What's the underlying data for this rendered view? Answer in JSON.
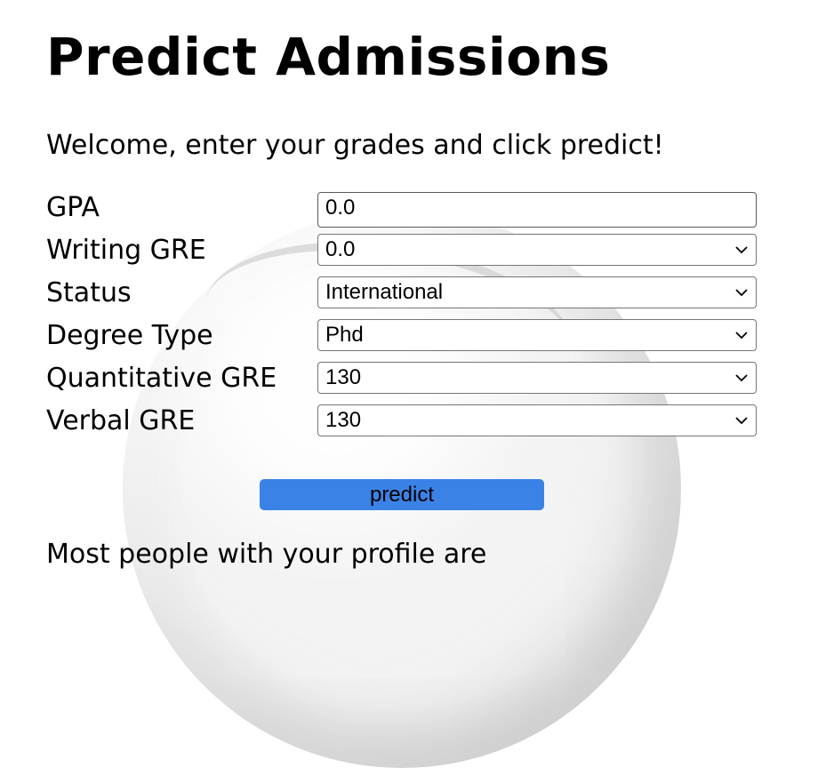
{
  "title": "Predict Admissions",
  "welcome": "Welcome, enter your grades and click predict!",
  "form": {
    "gpa": {
      "label": "GPA",
      "value": "0.0"
    },
    "writing_gre": {
      "label": "Writing GRE",
      "value": "0.0"
    },
    "status": {
      "label": "Status",
      "value": "International"
    },
    "degree_type": {
      "label": "Degree Type",
      "value": "Phd"
    },
    "quantitative_gre": {
      "label": "Quantitative GRE",
      "value": "130"
    },
    "verbal_gre": {
      "label": "Verbal GRE",
      "value": "130"
    }
  },
  "predict_button": "predict",
  "result_prefix": "Most people with your profile are",
  "colors": {
    "button": "#3b82e6"
  },
  "icons": {
    "select": "chevron-down-icon",
    "background": "crystal-ball"
  }
}
